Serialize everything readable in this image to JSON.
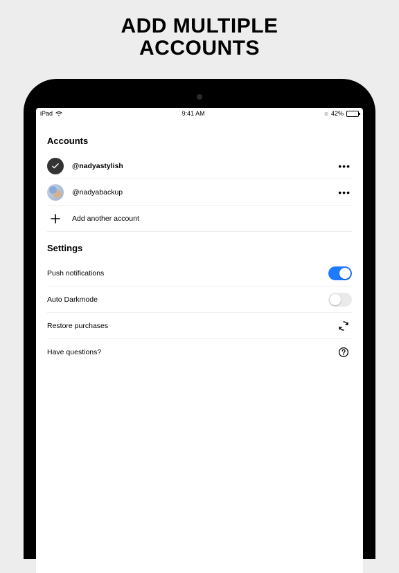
{
  "promo": {
    "line1": "ADD MULTIPLE",
    "line2": "ACCOUNTS"
  },
  "status": {
    "device": "iPad",
    "time": "9:41 AM",
    "battery_pct": "42%"
  },
  "accounts": {
    "title": "Accounts",
    "items": [
      {
        "handle": "@nadyastylish"
      },
      {
        "handle": "@nadyabackup"
      }
    ],
    "add_label": "Add another account"
  },
  "settings": {
    "title": "Settings",
    "push_label": "Push notifications",
    "darkmode_label": "Auto Darkmode",
    "restore_label": "Restore purchases",
    "help_label": "Have questions?"
  }
}
